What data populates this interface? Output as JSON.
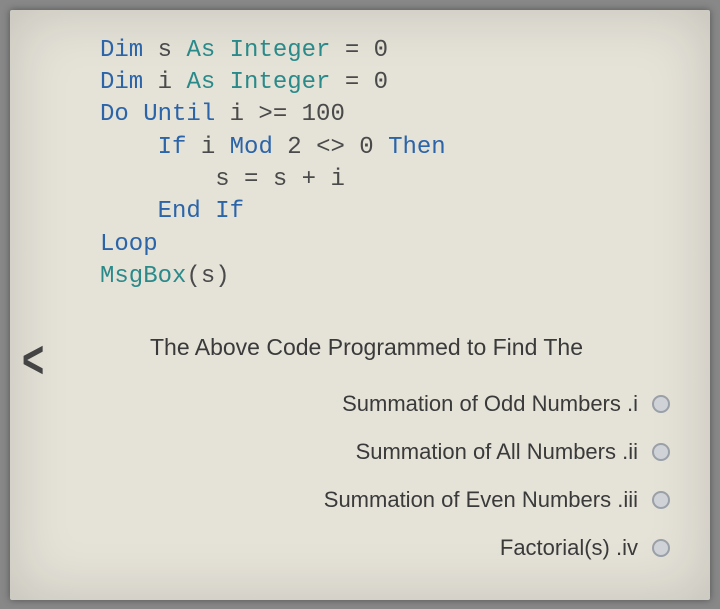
{
  "code": {
    "l1_kw1": "Dim",
    "l1_var": " s ",
    "l1_kw2": "As Integer",
    "l1_rest": " = 0",
    "l2_kw1": "Dim",
    "l2_var": " i ",
    "l2_kw2": "As Integer",
    "l2_rest": " = 0",
    "l3_kw": "Do Until",
    "l3_rest": " i >= 100",
    "l4_kw": "If",
    "l4_mid": " i ",
    "l4_kw2": "Mod",
    "l4_mid2": " 2 <> 0 ",
    "l4_kw3": "Then",
    "l5": "        s = s + i",
    "l6_kw": "End If",
    "l7_kw": "Loop",
    "l8_fn": "MsgBox",
    "l8_rest": "(s)"
  },
  "question": "The Above Code Programmed to Find The",
  "options": {
    "i": "Summation of Odd Numbers .i",
    "ii": "Summation of All Numbers .ii",
    "iii": "Summation of Even Numbers .iii",
    "iv": "Factorial(s) .iv"
  },
  "back": "<"
}
